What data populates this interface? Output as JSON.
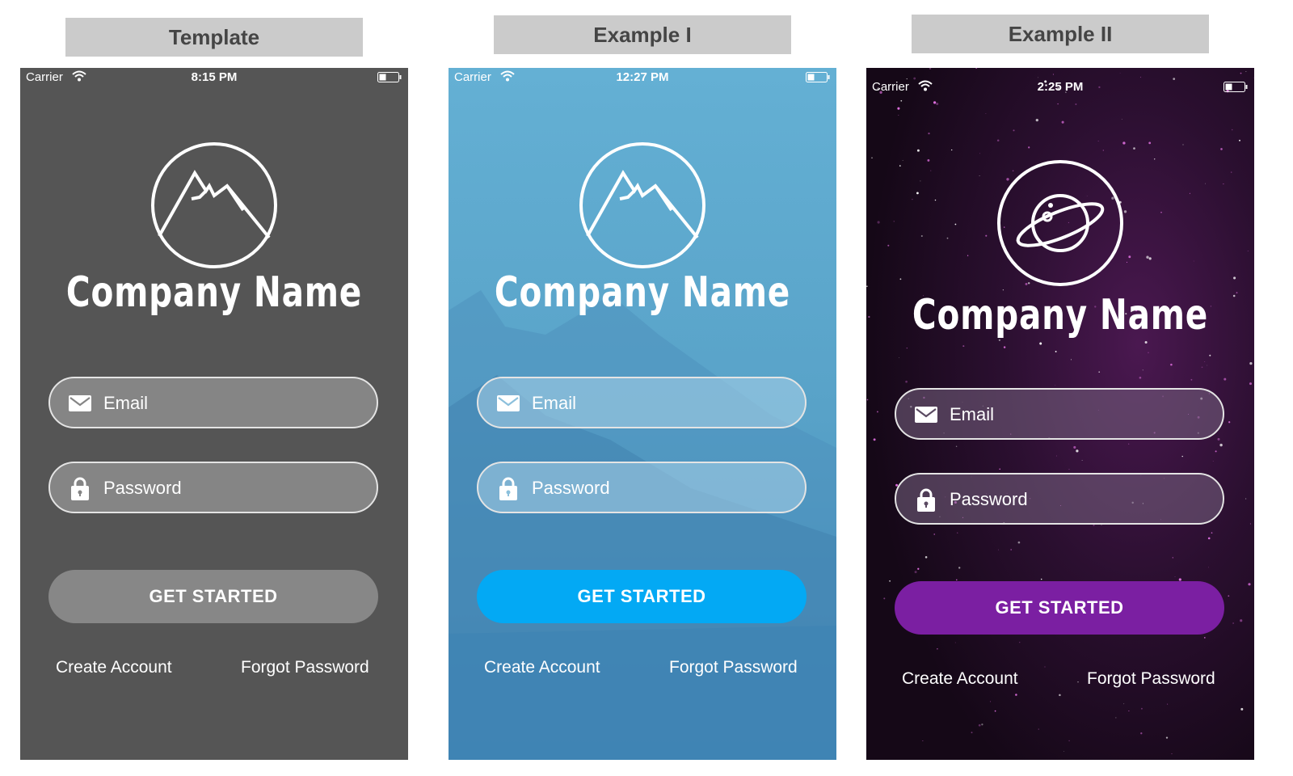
{
  "panels": [
    {
      "label": "Template",
      "status": {
        "carrier": "Carrier",
        "time": "8:15 PM"
      },
      "logo": "mountain-icon",
      "company_name": "Company Name",
      "email_placeholder": "Email",
      "password_placeholder": "Password",
      "button_label": "GET STARTED",
      "create_account": "Create Account",
      "forgot_password": "Forgot Password",
      "colors": {
        "background": "#555555",
        "field": "#858585",
        "button": "#878787"
      }
    },
    {
      "label": "Example I",
      "status": {
        "carrier": "Carrier",
        "time": "12:27 PM"
      },
      "logo": "mountain-icon",
      "company_name": "Company Name",
      "email_placeholder": "Email",
      "password_placeholder": "Password",
      "button_label": "GET STARTED",
      "create_account": "Create Account",
      "forgot_password": "Forgot Password",
      "colors": {
        "background": "#5aa6cd",
        "field": "#8cc0dc",
        "button": "#03a9f4"
      }
    },
    {
      "label": "Example II",
      "status": {
        "carrier": "Carrier",
        "time": "2:25 PM"
      },
      "logo": "planet-icon",
      "company_name": "Company Name",
      "email_placeholder": "Email",
      "password_placeholder": "Password",
      "button_label": "GET STARTED",
      "create_account": "Create Account",
      "forgot_password": "Forgot Password",
      "colors": {
        "background": "#1c0a20",
        "field": "#5b4a62",
        "button": "#7b1fa2"
      }
    }
  ]
}
